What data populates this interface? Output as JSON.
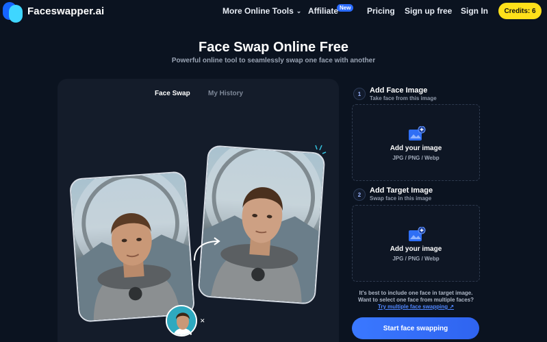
{
  "header": {
    "brand": "Faceswapper.ai",
    "nav": {
      "more_tools": "More Online Tools",
      "affiliate": "Affiliate",
      "new_badge": "New",
      "pricing": "Pricing",
      "signup": "Sign up free",
      "signin": "Sign In",
      "credits": "Credits: 6"
    }
  },
  "hero": {
    "title": "Face Swap Online Free",
    "subtitle": "Powerful online tool to seamlessly swap one face with another"
  },
  "tabs": [
    {
      "label": "Face Swap",
      "active": true
    },
    {
      "label": "My History",
      "active": false
    }
  ],
  "steps": [
    {
      "number": "1",
      "title": "Add Face Image",
      "subtitle": "Take face from this image",
      "dropzone_label": "Add your image",
      "formats": "JPG / PNG / Webp"
    },
    {
      "number": "2",
      "title": "Add Target Image",
      "subtitle": "Swap face in this image",
      "dropzone_label": "Add your image",
      "formats": "JPG / PNG / Webp"
    }
  ],
  "hint": {
    "line1": "It's best to include one face in target image.",
    "line2": "Want to select one face from multiple faces?",
    "link": "Try multiple face swapping ↗"
  },
  "start_button": "Start face swapping",
  "colors": {
    "background": "#0b1320",
    "panel": "#141c2a",
    "accent": "#3a78ff",
    "credits": "#ffe01a"
  }
}
